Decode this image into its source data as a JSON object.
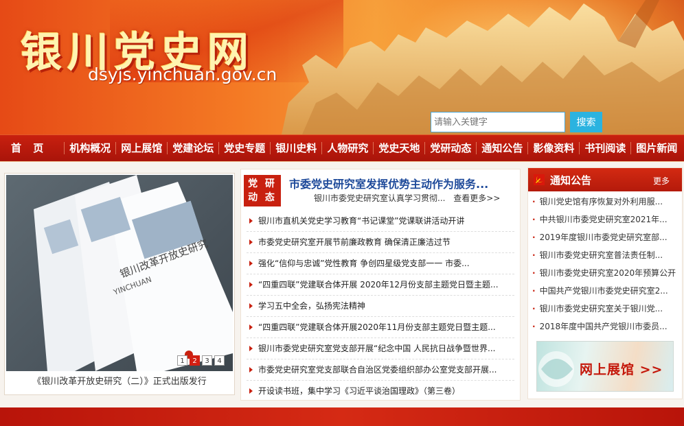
{
  "header": {
    "title": "银川党史网",
    "domain": "dsyjs.yinchuan.gov.cn",
    "search": {
      "placeholder": "请输入关键字",
      "button": "搜索"
    }
  },
  "nav": [
    "首 页",
    "机构概况",
    "网上展馆",
    "党建论坛",
    "党史专题",
    "银川史料",
    "人物研究",
    "党史天地",
    "党研动态",
    "通知公告",
    "影像资料",
    "书刊阅读",
    "图片新闻"
  ],
  "slider": {
    "caption": "《银川改革开放史研究（二）》正式出版发行",
    "pages": [
      "1",
      "2",
      "3",
      "4"
    ],
    "active_page": "2",
    "book_title": "银川改革开放史研究",
    "book_subtitle": "YINCHUAN"
  },
  "news": {
    "badge": [
      "党 研",
      "动 态"
    ],
    "headline": "市委党史研究室发挥优势主动作为服务...",
    "headline_sub": "银川市委党史研究室认真学习贯彻...",
    "more": "查看更多>>",
    "items": [
      "银川市直机关党史学习教育“书记课堂”党课联讲活动开讲",
      "市委党史研究室开展节前廉政教育 确保清正廉洁过节",
      "强化“信仰与忠诚”党性教育 争创四星级党支部一一 市委...",
      "“四重四联”党建联合体开展 2020年12月份支部主题党日暨主题...",
      "学习五中全会，弘扬宪法精神",
      "“四重四联”党建联合体开展2020年11月份支部主题党日暨主题...",
      "银川市委党史研究室党支部开展“纪念中国 人民抗日战争暨世界...",
      "市委党史研究室党支部联合自治区党委组织部办公室党支部开展...",
      "开设读书班，集中学习《习近平谈治国理政》（第三卷）"
    ]
  },
  "notice": {
    "title": "通知公告",
    "more": "更多",
    "items": [
      "银川党史馆有序恢复对外利用服...",
      "中共银川市委党史研究室2021年...",
      "2019年度银川市委党史研究室部...",
      "银川市委党史研究室普法责任制...",
      "银川市委党史研究室2020年预算公开",
      "中国共产党银川市委党史研究室2...",
      "银川市委党史研究室关于银川党...",
      "2018年度中国共产党银川市委员..."
    ],
    "exhibit": "网上展馆 >>"
  },
  "colors": {
    "accent": "#c8200f",
    "link": "#1e4a9a",
    "search": "#2bb3e0"
  }
}
